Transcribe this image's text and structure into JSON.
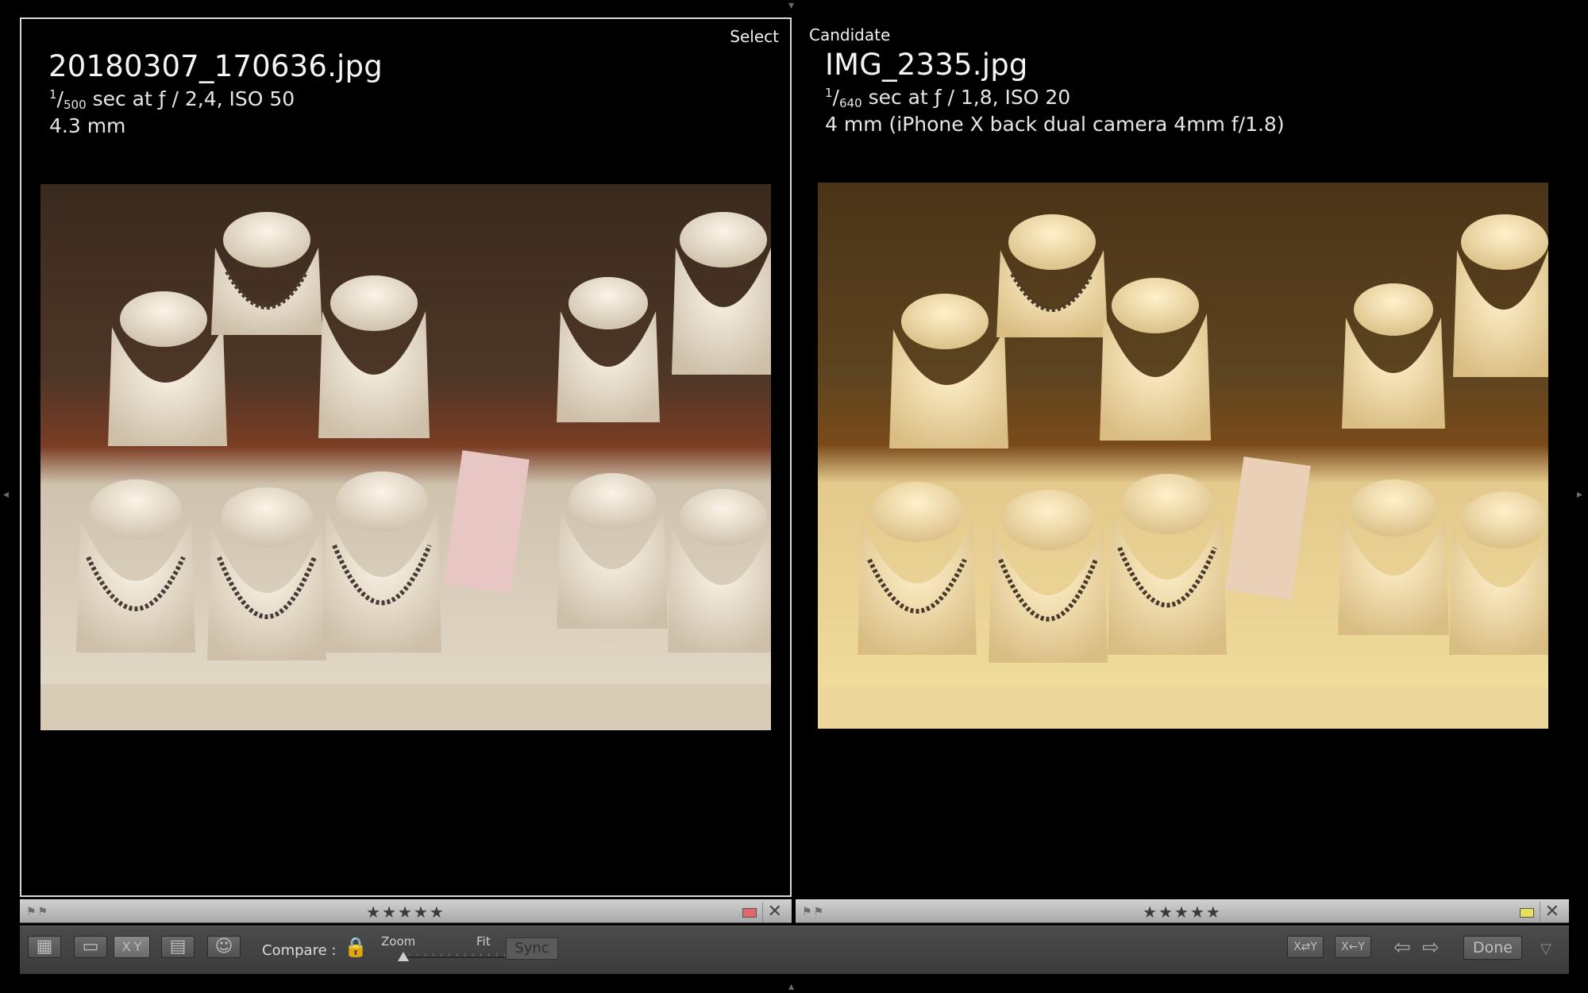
{
  "left_pane": {
    "tag": "Select",
    "filename": "20180307_170636.jpg",
    "shutter_num": "1",
    "shutter_den": "500",
    "exposure_rest": " sec at ƒ / 2,4, ISO 50",
    "focal": "4.3 mm"
  },
  "right_pane": {
    "tag": "Candidate",
    "filename": "IMG_2335.jpg",
    "shutter_num": "1",
    "shutter_den": "640",
    "exposure_rest": " sec at ƒ / 1,8, ISO 20",
    "focal": "4 mm (iPhone X back dual camera 4mm f/1.8)"
  },
  "left_info": {
    "flags": "⚑⚑",
    "stars": "★★★★★",
    "color_label": "#e0676a",
    "close": "✕"
  },
  "right_info": {
    "flags": "⚑⚑",
    "stars": "★★★★★",
    "color_label": "#e8df5a",
    "close": "✕"
  },
  "toolbar": {
    "grid_icon": "▦",
    "loupe_icon": "▭",
    "compare_label_x": "X",
    "compare_label_y": "Y",
    "survey_icon": "▤",
    "people_icon": "☺",
    "compare_label": "Compare :",
    "lock_icon": "🔒",
    "zoom_label": "Zoom",
    "fit_label": "Fit",
    "zoom_level": 0.0,
    "sync_label": "Sync",
    "swap_label": "X⇄Y",
    "make_select_label": "X←Y",
    "prev_arrow": "⇦",
    "next_arrow": "⇨",
    "done_label": "Done",
    "menu_arrow": "▽"
  }
}
